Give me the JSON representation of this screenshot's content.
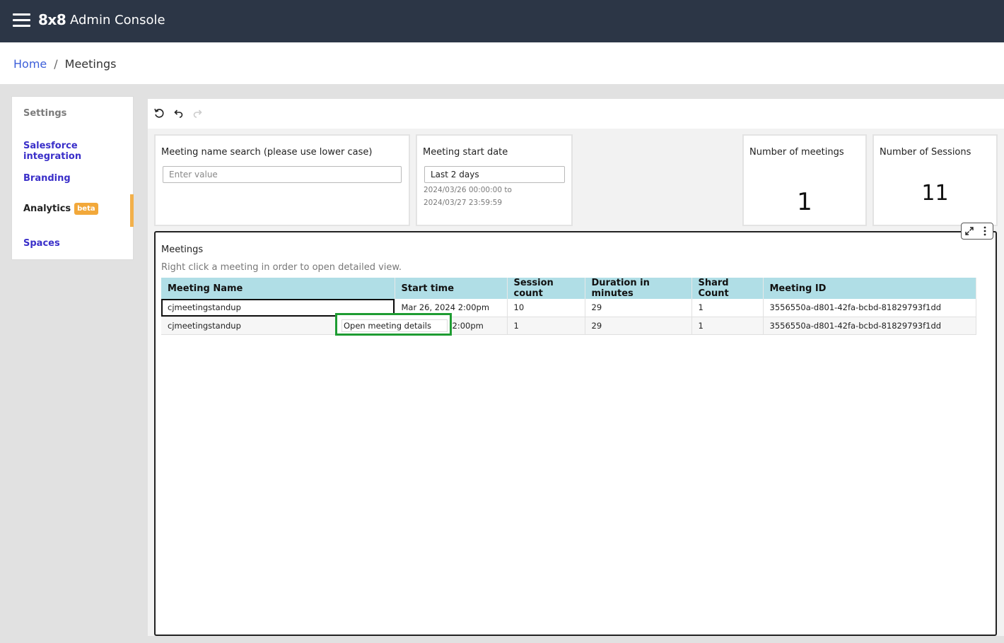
{
  "header": {
    "logo": "8x8",
    "title": "Admin Console"
  },
  "breadcrumb": {
    "home": "Home",
    "separator": "/",
    "current": "Meetings"
  },
  "sidebar": {
    "heading": "Settings",
    "items": [
      {
        "label": "Salesforce integration"
      },
      {
        "label": "Branding"
      },
      {
        "label": "Analytics",
        "badge": "beta",
        "active": true
      },
      {
        "label": "Spaces"
      }
    ]
  },
  "filters": {
    "name_search": {
      "title": "Meeting name search (please use lower case)",
      "placeholder": "Enter value"
    },
    "start_date": {
      "title": "Meeting start date",
      "value": "Last 2 days",
      "range_from": "2024/03/26 00:00:00 to",
      "range_to": "2024/03/27 23:59:59"
    }
  },
  "kpis": {
    "meetings": {
      "title": "Number of meetings",
      "value": "1"
    },
    "sessions": {
      "title": "Number of Sessions",
      "value": "11"
    }
  },
  "meetings_visual": {
    "title": "Meetings",
    "subtitle": "Right click a meeting in order to open detailed view.",
    "columns": [
      "Meeting Name",
      "Start time",
      "Session count",
      "Duration in minutes",
      "Shard Count",
      "Meeting ID"
    ],
    "rows": [
      [
        "cjmeetingstandup",
        "Mar 26, 2024 2:00pm",
        "10",
        "29",
        "1",
        "3556550a-d801-42fa-bcbd-81829793f1dd"
      ],
      [
        "cjmeetingstandup",
        "2:00pm",
        "1",
        "29",
        "1",
        "3556550a-d801-42fa-bcbd-81829793f1dd"
      ]
    ]
  },
  "context_menu": {
    "item": "Open meeting details"
  },
  "colors": {
    "topbar": "#2c3646",
    "link": "#3d5fd9",
    "table_header": "#b0dee6",
    "beta_badge": "#f2a83a",
    "context_border": "#1e9c32"
  }
}
